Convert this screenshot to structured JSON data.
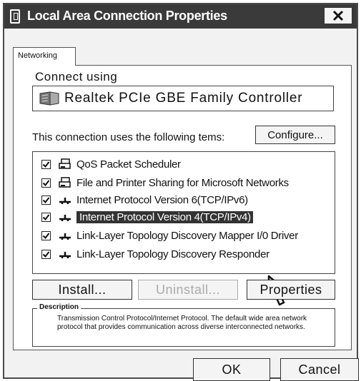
{
  "window": {
    "title": "Local Area Connection Properties",
    "close_label": "X"
  },
  "tabs": [
    {
      "label": "Networking"
    }
  ],
  "connect_using": {
    "label": "Connect using",
    "adapter": "Realtek PCIe GBE Family Controller"
  },
  "items_label": "This connection uses the following tems:",
  "buttons": {
    "configure": "Configure...",
    "install": "Install...",
    "uninstall": "Uninstall...",
    "properties": "Properties",
    "ok": "OK",
    "cancel": "Cancel"
  },
  "items": [
    {
      "label": "QoS Packet Scheduler",
      "checked": true,
      "icon": "service-icon",
      "selected": false
    },
    {
      "label": "File and Printer Sharing for Microsoft Networks",
      "checked": true,
      "icon": "service-icon",
      "selected": false
    },
    {
      "label": "Internet Protocol Version 6(TCP/IPv6)",
      "checked": true,
      "icon": "protocol-icon",
      "selected": false
    },
    {
      "label": "Internet Protocol Version 4(TCP/IPv4)",
      "checked": true,
      "icon": "protocol-icon",
      "selected": true
    },
    {
      "label": "Link-Layer Topology Discovery Mapper I/0 Driver",
      "checked": true,
      "icon": "protocol-icon",
      "selected": false
    },
    {
      "label": "Link-Layer Topology Discovery Responder",
      "checked": true,
      "icon": "protocol-icon",
      "selected": false
    }
  ],
  "description": {
    "legend": "Description",
    "text": "Transmission Control Protocol/Internet Protocol. The default wide area network protocol that provides communication across diverse interconnected networks."
  }
}
